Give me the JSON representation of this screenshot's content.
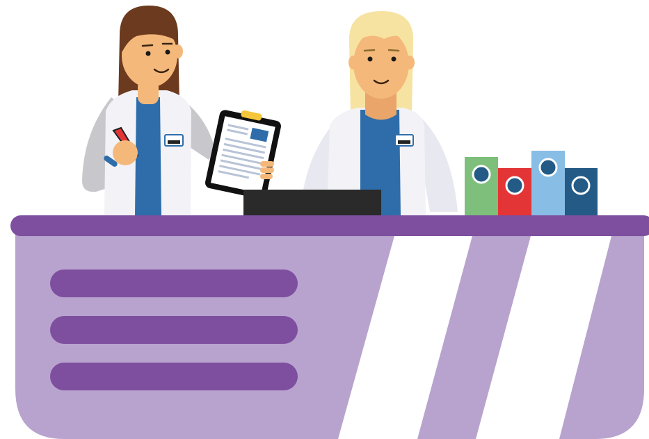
{
  "scene": {
    "description_visible_text": [],
    "colors": {
      "desk_top": "#7E4F9E",
      "desk_body": "#B8A3CE",
      "coat": "#F2F2F7",
      "scrub": "#2E6DAA",
      "skin": "#F4B97A",
      "hair_brown": "#6B3A1F",
      "hair_blonde": "#F7E3A1",
      "binder_green": "#7DBF7B",
      "binder_red": "#E33535",
      "binder_lightblue": "#88BDE6",
      "binder_navy": "#245A86",
      "monitor": "#2A2A2A"
    },
    "icons": [
      "doctor-brunette",
      "doctor-blonde",
      "clipboard",
      "pen",
      "monitor",
      "binders",
      "reception-desk"
    ]
  }
}
